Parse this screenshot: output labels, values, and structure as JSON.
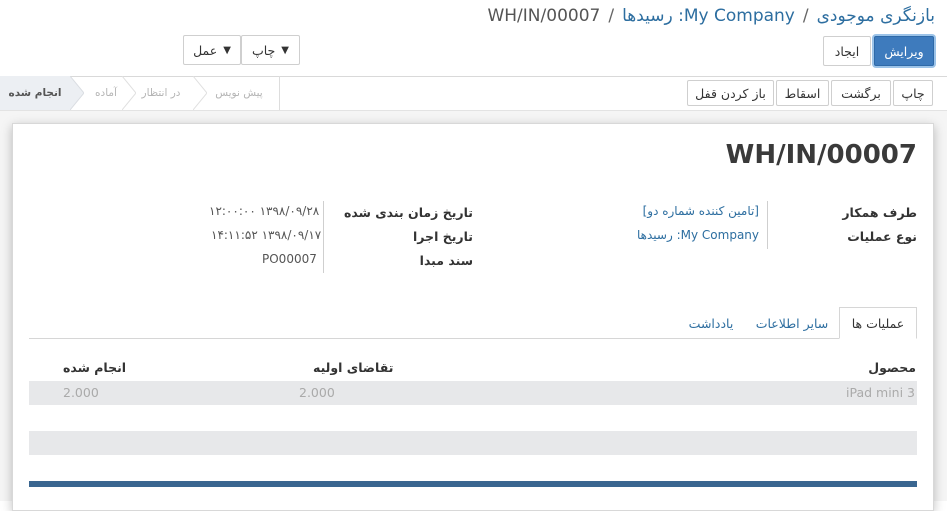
{
  "breadcrumb": {
    "root": "بازنگری موجودی",
    "middle": "My Company: رسیدها",
    "current": "WH/IN/00007",
    "sep1": "/",
    "sep2": "/"
  },
  "control_panel": {
    "edit_label": "ویرایش",
    "create_label": "ایجاد",
    "print_dropdown_label": "چاپ",
    "action_dropdown_label": "عمل"
  },
  "header_buttons": {
    "print_label": "چاپ",
    "return_label": "برگشت",
    "cancel_label": "اسقاط",
    "unlock_label": "باز کردن قفل"
  },
  "statusbar": {
    "stages": [
      "انجام شده",
      "آماده",
      "در انتظار",
      "پیش نویس"
    ],
    "active_index": 0
  },
  "record": {
    "name": "WH/IN/00007",
    "partner_label": "طرف همکار",
    "partner_value": "[تامین کننده شماره دو]",
    "operation_type_label": "نوع عملیات",
    "operation_type_value": "My Company: رسیدها",
    "scheduled_date_label": "تاریخ زمان بندی شده",
    "scheduled_date_value": "۱۳۹۸/۰۹/۲۸ ۱۲:۰۰:۰۰",
    "date_done_label": "تاریخ اجرا",
    "date_done_value": "۱۳۹۸/۰۹/۱۷ ۱۴:۱۱:۵۲",
    "origin_label": "سند مبدا",
    "origin_value": "PO00007"
  },
  "tabs": [
    "عملیات ها",
    "سایر اطلاعات",
    "یادداشت"
  ],
  "active_tab": 0,
  "table": {
    "columns": [
      "محصول",
      "تقاضای اولیه",
      "انجام شده"
    ],
    "rows": [
      {
        "product": "iPad mini 3",
        "demand": "2.000",
        "done": "2.000"
      }
    ]
  },
  "colors": {
    "primary": "#3e7bbd",
    "link": "#2d6ea0",
    "bottom_bar": "#3a6690"
  }
}
